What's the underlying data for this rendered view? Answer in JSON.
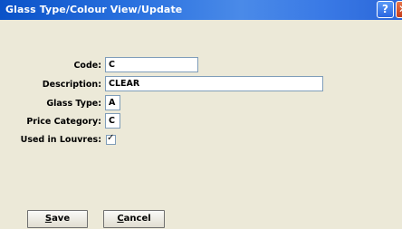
{
  "window": {
    "title": "Glass Type/Colour View/Update",
    "help_label": "?",
    "close_label": "✕"
  },
  "form": {
    "code_label": "Code:",
    "code_value": "C",
    "description_label": "Description:",
    "description_value": "CLEAR",
    "glass_type_label": "Glass Type:",
    "glass_type_value": "A",
    "price_category_label": "Price Category:",
    "price_category_value": "C",
    "used_in_louvres_label": "Used in Louvres:",
    "used_in_louvres_checked": true,
    "check_mark": "✓"
  },
  "buttons": {
    "save_mnemonic": "S",
    "save_rest": "ave",
    "cancel_mnemonic": "C",
    "cancel_rest": "ancel"
  }
}
